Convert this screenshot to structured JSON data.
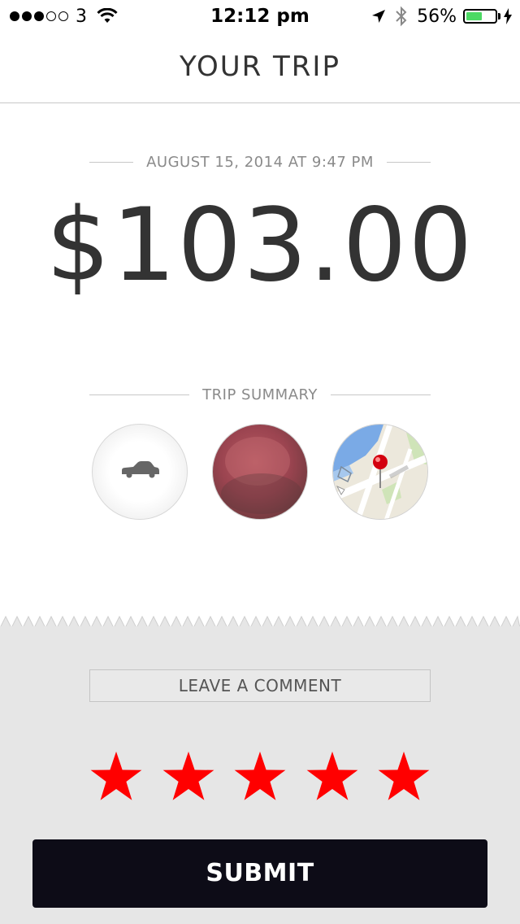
{
  "status_bar": {
    "carrier": "3",
    "time": "12:12 pm",
    "battery_percent": "56%",
    "battery_level": 0.56,
    "signal_bars_filled": 3,
    "signal_bars_total": 5,
    "icons": [
      "wifi-icon",
      "location-arrow-icon",
      "bluetooth-icon",
      "charging-bolt-icon"
    ]
  },
  "header": {
    "title": "YOUR TRIP"
  },
  "trip": {
    "datetime": "AUGUST 15, 2014 AT 9:47 PM",
    "fare": "$103.00"
  },
  "summary": {
    "label": "TRIP SUMMARY",
    "items": [
      "car-icon",
      "driver-photo",
      "route-map-thumbnail"
    ]
  },
  "rating": {
    "comment_label": "LEAVE A COMMENT",
    "stars_selected": 5,
    "stars_total": 5,
    "star_color": "#ff0000",
    "submit_label": "SUBMIT"
  },
  "colors": {
    "submit_bg": "#0d0c17",
    "rating_bg": "#e6e6e6",
    "battery_fill": "#4cd964"
  }
}
